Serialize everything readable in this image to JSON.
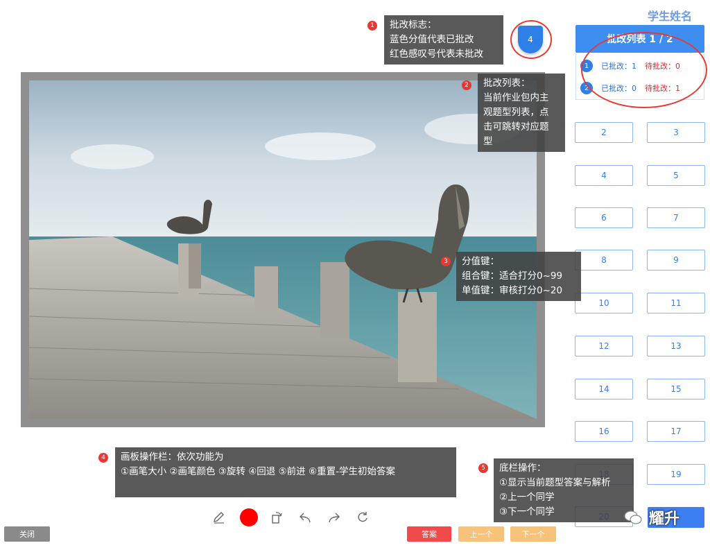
{
  "student_name": "学生姓名",
  "score_badge": "4",
  "review_list": {
    "title": "批改列表 1 / 2",
    "rows": [
      {
        "num": "1",
        "done": "已批改：1",
        "pending": "待批改：0"
      },
      {
        "num": "2",
        "done": "已批改：0",
        "pending": "待批改：1"
      }
    ]
  },
  "questions": [
    "2",
    "3",
    "4",
    "5",
    "6",
    "7",
    "8",
    "9",
    "10",
    "11",
    "12",
    "13",
    "14",
    "15",
    "16",
    "17",
    "18",
    "19",
    "20"
  ],
  "tips": {
    "t1": {
      "num": "1",
      "lines": [
        "批改标志：",
        "蓝色分值代表已批改",
        "红色感叹号代表未批改"
      ]
    },
    "t2": {
      "num": "2",
      "lines": [
        "批改列表：",
        "当前作业包内主",
        "观题型列表，点",
        "击可跳转对应题",
        "型"
      ]
    },
    "t3": {
      "num": "3",
      "lines": [
        "分值键：",
        "组合键：适合打分0~99",
        "单值键：审核打分0~20"
      ]
    },
    "t4": {
      "num": "4",
      "lines": [
        "画板操作栏：依次功能为",
        "①画笔大小  ②画笔颜色 ③旋转 ④回退 ⑤前进 ⑥重置-学生初始答案"
      ]
    },
    "t5": {
      "num": "5",
      "lines": [
        "底栏操作：",
        "①显示当前题型答案与解析",
        "②上一个同学",
        "③下一个同学"
      ]
    }
  },
  "toolbar": {
    "icons": [
      "pen-icon",
      "color-dot-icon",
      "rotate-icon",
      "undo-icon",
      "redo-icon",
      "reset-icon"
    ],
    "pen_color": "#ff0000"
  },
  "bottom": {
    "close": "关闭",
    "answer": "答案",
    "prev": "上一个",
    "next": "下一个"
  },
  "watermark": "耀升"
}
